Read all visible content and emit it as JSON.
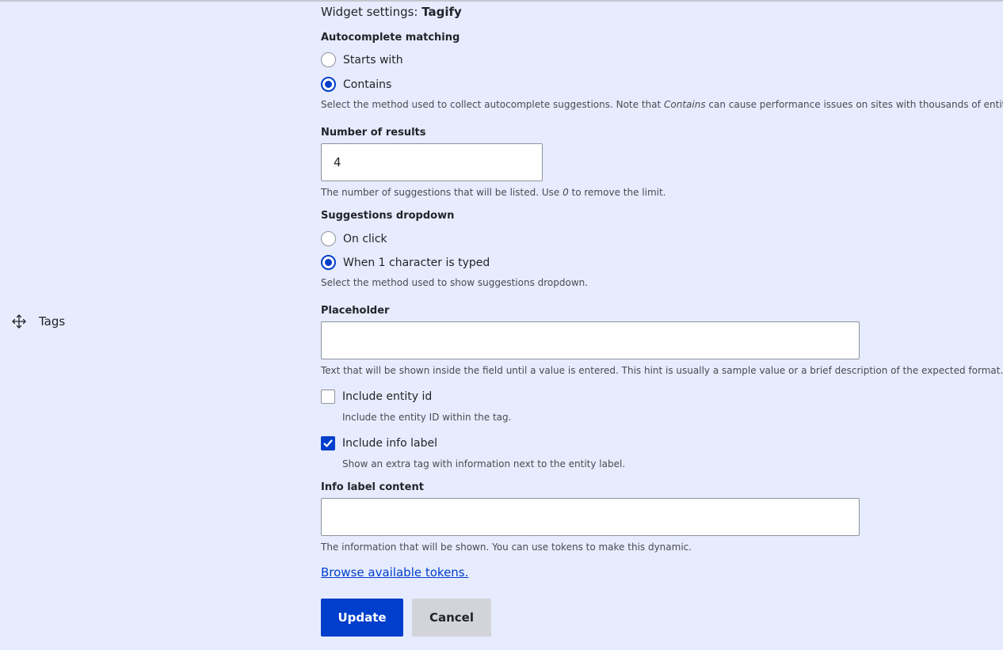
{
  "row": {
    "label": "Tags",
    "drag_icon": "move-arrows-icon"
  },
  "widget": {
    "heading_prefix": "Widget settings: ",
    "heading_name": "Tagify"
  },
  "autocomplete": {
    "label": "Autocomplete matching",
    "options": [
      "Starts with",
      "Contains"
    ],
    "selected": "Contains",
    "desc_before": "Select the method used to collect autocomplete suggestions. Note that ",
    "desc_em": "Contains",
    "desc_after": " can cause performance issues on sites with thousands of entities."
  },
  "results": {
    "label": "Number of results",
    "value": "4",
    "desc_before": "The number of suggestions that will be listed. Use ",
    "desc_em": "0",
    "desc_after": " to remove the limit."
  },
  "dropdown": {
    "label": "Suggestions dropdown",
    "options": [
      "On click",
      "When 1 character is typed"
    ],
    "selected": "When 1 character is typed",
    "desc": "Select the method used to show suggestions dropdown."
  },
  "placeholder": {
    "label": "Placeholder",
    "value": "",
    "desc": "Text that will be shown inside the field until a value is entered. This hint is usually a sample value or a brief description of the expected format."
  },
  "entity_id": {
    "label": "Include entity id",
    "checked": false,
    "desc": "Include the entity ID within the tag."
  },
  "info_label": {
    "label": "Include info label",
    "checked": true,
    "desc": "Show an extra tag with information next to the entity label."
  },
  "info_content": {
    "label": "Info label content",
    "value": "",
    "desc": "The information that will be shown. You can use tokens to make this dynamic."
  },
  "tokens_link": "Browse available tokens.",
  "buttons": {
    "update": "Update",
    "cancel": "Cancel"
  },
  "colors": {
    "accent": "#003ecc",
    "background": "#e6ecfd"
  }
}
